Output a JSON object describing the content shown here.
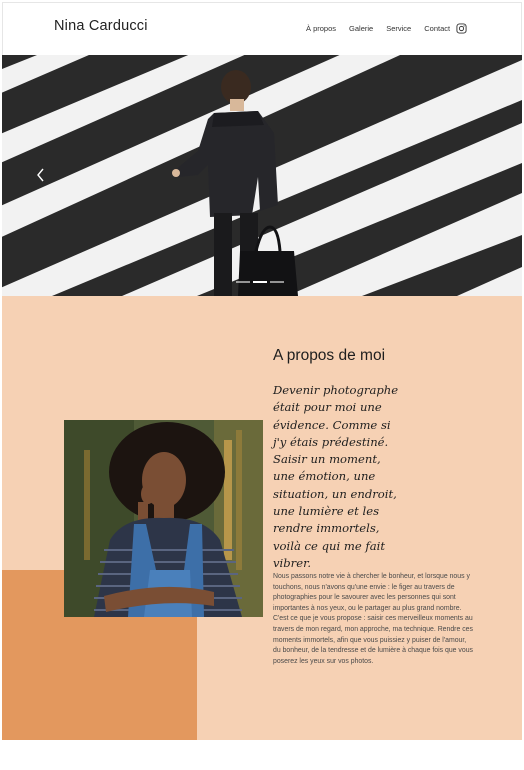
{
  "header": {
    "site_title": "Nina Carducci",
    "nav": [
      {
        "label": "À propos"
      },
      {
        "label": "Galerie"
      },
      {
        "label": "Service"
      },
      {
        "label": "Contact"
      }
    ],
    "social_icon": "instagram-icon"
  },
  "hero": {
    "image": "man-in-suit-walking-on-crosswalk",
    "prev_icon": "chevron-left-icon",
    "carousel_dots": 3,
    "active_dot": 1
  },
  "about": {
    "heading": "A propos de moi",
    "quote": "Devenir photographe était pour moi une évidence. Comme si j'y étais prédestiné. Saisir un moment, une émotion, une situation, un endroit, une lumière et les rendre immortels, voilà ce qui me fait vibrer.",
    "body": "Nous passons notre vie à chercher le bonheur, et lorsque nous y touchons, nous n'avons qu'une envie : le figer au travers de photographies pour le savourer avec les personnes qui sont importantes à nos yeux, ou le partager au plus grand nombre. C'est ce que je vous propose : saisir ces merveilleux moments au travers de mon regard, mon approche, ma technique. Rendre ces moments immortels, afin que vous puissiez y puiser de l'amour, du bonheur, de la tendresse et de lumière à chaque fois que vous poserez les yeux sur vos photos.",
    "portrait": "woman-in-denim-overalls-portrait"
  },
  "colors": {
    "section_bg": "#f6d1b4",
    "accent": "#e3985e"
  }
}
